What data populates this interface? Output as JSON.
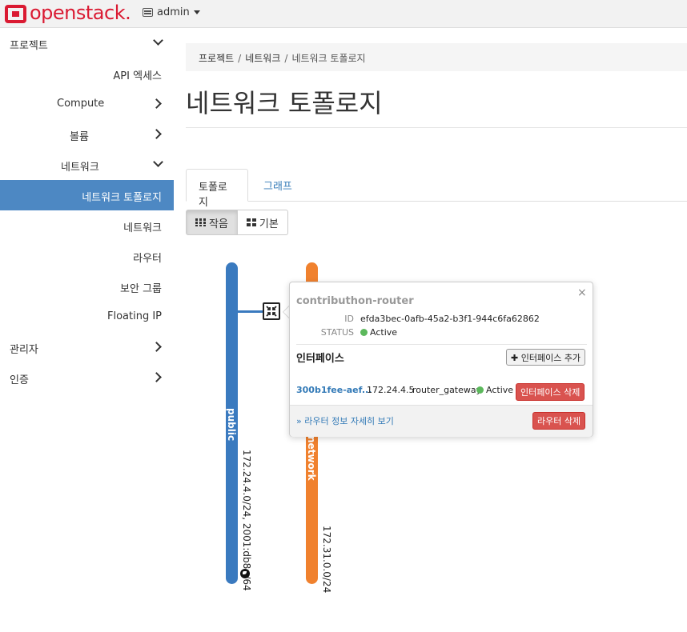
{
  "navbar": {
    "brand": "openstack.",
    "project": "admin"
  },
  "sidebar": {
    "items": [
      {
        "label": "프로젝트",
        "chevron": "down"
      },
      {
        "label": "API 엑세스"
      },
      {
        "label": "Compute",
        "chevron": "right"
      },
      {
        "label": "볼륨",
        "chevron": "right"
      },
      {
        "label": "네트워크",
        "chevron": "down"
      },
      {
        "label": "네트워크 토폴로지",
        "active": true
      },
      {
        "label": "네트워크"
      },
      {
        "label": "라우터"
      },
      {
        "label": "보안 그룹"
      },
      {
        "label": "Floating IP"
      },
      {
        "label": "관리자",
        "chevron": "right"
      },
      {
        "label": "인증",
        "chevron": "right"
      }
    ]
  },
  "breadcrumb": {
    "items": [
      "프로젝트",
      "네트워크"
    ],
    "current": "네트워크 토폴로지",
    "separator": "/"
  },
  "page_title": "네트워크 토폴로지",
  "tabs": {
    "active": "토폴로지",
    "inactive": "그래프"
  },
  "view_toggle": {
    "small": "작음",
    "normal": "기본"
  },
  "topology": {
    "public_network": {
      "name": "public",
      "cidr": "172.24.4.0/24, 2001:db8::/64",
      "color": "#3a7abf"
    },
    "private_network": {
      "name": "network",
      "cidr": "172.31.0.0/24",
      "color": "#f0812e"
    }
  },
  "router_popup": {
    "name": "contributhon-router",
    "id_label": "ID",
    "id_value": "efda3bec-0afb-45a2-b3f1-944c6fa62862",
    "status_label": "STATUS",
    "status_value": "Active",
    "interfaces_title": "인터페이스",
    "add_interface": "인터페이스 추가",
    "interface": {
      "id": "300b1fee-aef...",
      "ip": "172.24.4.5",
      "owner": "router_gateway",
      "status": "Active",
      "delete": "인터페이스 삭제"
    },
    "details_link": "» 라우터 정보 자세히 보기",
    "delete_router": "라우터 삭제",
    "close": "×"
  }
}
